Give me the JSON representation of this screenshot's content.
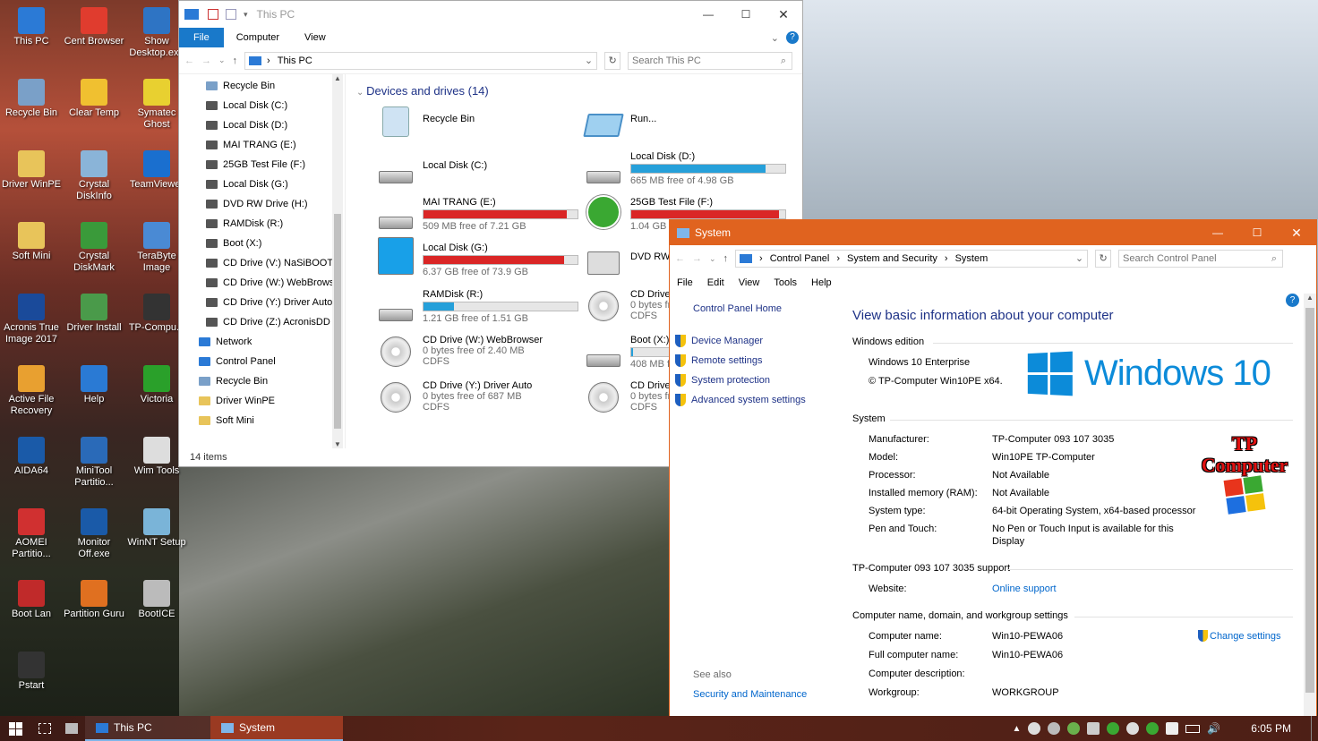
{
  "desktop": {
    "icons": [
      {
        "label": "This PC",
        "color": "#2b7ad6"
      },
      {
        "label": "Cent Browser",
        "color": "#e03c2e"
      },
      {
        "label": "Show Desktop.exe",
        "color": "#2e74c4"
      },
      {
        "label": "Recycle Bin",
        "color": "#7aa0c8"
      },
      {
        "label": "Clear Temp",
        "color": "#f0c030"
      },
      {
        "label": "Symatec Ghost",
        "color": "#e8d030"
      },
      {
        "label": "Driver WinPE",
        "color": "#e8c45a"
      },
      {
        "label": "Crystal DiskInfo",
        "color": "#8ab4d8"
      },
      {
        "label": "TeamViewer",
        "color": "#1a6fcf"
      },
      {
        "label": "Soft Mini",
        "color": "#e8c45a"
      },
      {
        "label": "Crystal DiskMark",
        "color": "#3a9a3a"
      },
      {
        "label": "TeraByte Image",
        "color": "#4a8ad4"
      },
      {
        "label": "Acronis True Image 2017",
        "color": "#1a4a9a"
      },
      {
        "label": "Driver Install",
        "color": "#4a9a4a"
      },
      {
        "label": "TP-Compu...",
        "color": "#333333"
      },
      {
        "label": "Active File Recovery",
        "color": "#e8a030"
      },
      {
        "label": "Help",
        "color": "#2a7ad4"
      },
      {
        "label": "Victoria",
        "color": "#2aa02a"
      },
      {
        "label": "AIDA64",
        "color": "#1a5aa8"
      },
      {
        "label": "MiniTool Partitio...",
        "color": "#2a6ab8"
      },
      {
        "label": "Wim Tools",
        "color": "#dddddd"
      },
      {
        "label": "AOMEI Partitio...",
        "color": "#d03030"
      },
      {
        "label": "Monitor Off.exe",
        "color": "#1a5aa8"
      },
      {
        "label": "WinNT Setup",
        "color": "#7ab4d8"
      },
      {
        "label": "Boot Lan",
        "color": "#c02a2a"
      },
      {
        "label": "Partition Guru",
        "color": "#e07020"
      },
      {
        "label": "BootICE",
        "color": "#bbbbbb"
      },
      {
        "label": "Pstart",
        "color": "#333333"
      }
    ]
  },
  "explorer": {
    "title": "This PC",
    "tabs": [
      "File",
      "Computer",
      "View"
    ],
    "address": "This PC",
    "search_placeholder": "Search This PC",
    "nav": [
      "Recycle Bin",
      "Local Disk (C:)",
      "Local Disk (D:)",
      "MAI TRANG (E:)",
      "25GB Test File (F:)",
      "Local Disk (G:)",
      "DVD RW Drive (H:)",
      "RAMDisk (R:)",
      "Boot (X:)",
      "CD Drive (V:) NaSiBOOT",
      "CD Drive (W:) WebBrows",
      "CD Drive (Y:) Driver Auto",
      "CD Drive (Z:) AcronisDD",
      "Network",
      "Control Panel",
      "Recycle Bin",
      "Driver WinPE",
      "Soft Mini"
    ],
    "section": "Devices and drives (14)",
    "status": "14 items",
    "drives": [
      {
        "name": "Recycle Bin",
        "free": "",
        "fs": "",
        "pct": null,
        "color": ""
      },
      {
        "name": "Run...",
        "free": "",
        "fs": "",
        "pct": null,
        "color": ""
      },
      {
        "name": "Local Disk (C:)",
        "free": "",
        "fs": "",
        "pct": null,
        "color": ""
      },
      {
        "name": "Local Disk (D:)",
        "free": "665 MB free of 4.98 GB",
        "fs": "",
        "pct": 87,
        "color": "#26a0da"
      },
      {
        "name": "MAI TRANG (E:)",
        "free": "509 MB free of 7.21 GB",
        "fs": "",
        "pct": 93,
        "color": "#da2626"
      },
      {
        "name": "25GB Test File (F:)",
        "free": "1.04 GB free of 25.0 GB",
        "fs": "",
        "pct": 96,
        "color": "#da2626"
      },
      {
        "name": "Local Disk (G:)",
        "free": "6.37 GB free of 73.9 GB",
        "fs": "",
        "pct": 91,
        "color": "#da2626"
      },
      {
        "name": "DVD RW Drive (H:)",
        "free": "",
        "fs": "",
        "pct": null,
        "color": ""
      },
      {
        "name": "RAMDisk (R:)",
        "free": "1.21 GB free of 1.51 GB",
        "fs": "",
        "pct": 20,
        "color": "#26a0da"
      },
      {
        "name": "CD Drive (V:) NaSiBOOT",
        "free": "0 bytes free of 4.56 MB",
        "fs": "CDFS",
        "pct": null,
        "color": ""
      },
      {
        "name": "CD Drive (W:) WebBrowser",
        "free": "0 bytes free of 2.40 MB",
        "fs": "CDFS",
        "pct": null,
        "color": ""
      },
      {
        "name": "Boot (X:)",
        "free": "408 MB free of 408 MB",
        "fs": "",
        "pct": 1,
        "color": "#26a0da"
      },
      {
        "name": "CD Drive (Y:) Driver Auto",
        "free": "0 bytes free of 687 MB",
        "fs": "CDFS",
        "pct": null,
        "color": ""
      },
      {
        "name": "CD Drive (Z:) AcronisDD",
        "free": "0 bytes free of 283 MB",
        "fs": "CDFS",
        "pct": null,
        "color": ""
      }
    ]
  },
  "system": {
    "title": "System",
    "breadcrumb": [
      "Control Panel",
      "System and Security",
      "System"
    ],
    "search_placeholder": "Search Control Panel",
    "menu": [
      "File",
      "Edit",
      "View",
      "Tools",
      "Help"
    ],
    "side_home": "Control Panel Home",
    "side_links": [
      "Device Manager",
      "Remote settings",
      "System protection",
      "Advanced system settings"
    ],
    "see_also": "See also",
    "see_also_link": "Security and Maintenance",
    "heading": "View basic information about your computer",
    "edition_label": "Windows edition",
    "edition": "Windows 10 Enterprise",
    "copyright": "© TP-Computer Win10PE x64.",
    "win_logo": "Windows 10",
    "system_label": "System",
    "rows": [
      {
        "k": "Manufacturer:",
        "v": "TP-Computer 093 107 3035"
      },
      {
        "k": "Model:",
        "v": "Win10PE TP-Computer"
      },
      {
        "k": "Processor:",
        "v": "Not Available"
      },
      {
        "k": "Installed memory (RAM):",
        "v": "Not Available"
      },
      {
        "k": "System type:",
        "v": "64-bit Operating System, x64-based processor"
      },
      {
        "k": "Pen and Touch:",
        "v": "No Pen or Touch Input is available for this Display"
      }
    ],
    "oem_logo_line1": "TP",
    "oem_logo_line2": "Computer",
    "support_label": "TP-Computer 093 107 3035 support",
    "website_label": "Website:",
    "website_link": "Online support",
    "name_label": "Computer name, domain, and workgroup settings",
    "change_settings": "Change settings",
    "name_rows": [
      {
        "k": "Computer name:",
        "v": "Win10-PEWA06"
      },
      {
        "k": "Full computer name:",
        "v": "Win10-PEWA06"
      },
      {
        "k": "Computer description:",
        "v": ""
      },
      {
        "k": "Workgroup:",
        "v": "WORKGROUP"
      }
    ]
  },
  "taskbar": {
    "items": [
      "This PC",
      "System"
    ],
    "clock": "6:05 PM"
  }
}
